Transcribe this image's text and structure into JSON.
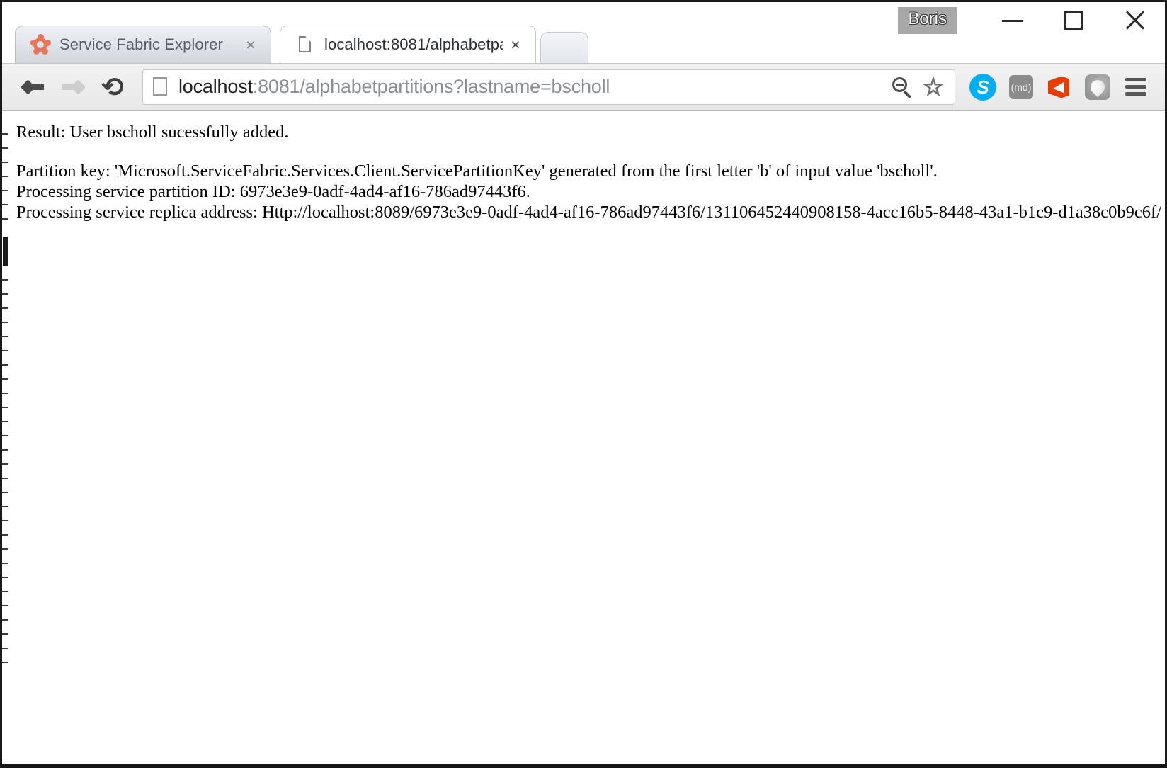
{
  "window": {
    "profile_label": "Boris",
    "controls": {
      "minimize": "minimize-button",
      "maximize": "maximize-button",
      "close": "close-button"
    }
  },
  "tabs": [
    {
      "title": "Service Fabric Explorer",
      "favicon": "service-fabric-molecule-icon",
      "close_label": "×",
      "active": false
    },
    {
      "title": "localhost:8081/alphabetpa",
      "favicon": "blank-page-icon",
      "close_label": "×",
      "active": true
    }
  ],
  "toolbar": {
    "back_label": "back-arrow",
    "forward_label": "forward-arrow",
    "reload_label": "⟳",
    "omnibox": {
      "page_icon": "document-icon",
      "url_host": "localhost",
      "url_rest": ":8081/alphabetpartitions?lastname=bscholl",
      "url_full": "localhost:8081/alphabetpartitions?lastname=bscholl",
      "zoom_out_icon": "zoom-out-icon",
      "bookmark_icon": "☆"
    },
    "extensions": [
      {
        "name": "skype-extension",
        "glyph": "S"
      },
      {
        "name": "md-extension",
        "glyph": "(md)"
      },
      {
        "name": "office-extension",
        "glyph": ""
      },
      {
        "name": "drop-extension",
        "glyph": ""
      }
    ],
    "menu_icon": "hamburger-menu-icon"
  },
  "content": {
    "lines": [
      "Result: User bscholl sucessfully added.",
      "",
      "Partition key: 'Microsoft.ServiceFabric.Services.Client.ServicePartitionKey' generated from the first letter 'b' of input value 'bscholl'.",
      "Processing service partition ID: 6973e3e9-0adf-4ad4-af16-786ad97443f6.",
      "Processing service replica address: Http://localhost:8089/6973e3e9-0adf-4ad4-af16-786ad97443f6/131106452440908158-4acc16b5-8448-43a1-b1c9-d1a38c0b9c6f/"
    ],
    "line_0": "Result: User bscholl sucessfully added.",
    "line_2": "Partition key: 'Microsoft.ServiceFabric.Services.Client.ServicePartitionKey' generated from the first letter 'b' of input value 'bscholl'.",
    "line_3": "Processing service partition ID: 6973e3e9-0adf-4ad4-af16-786ad97443f6.",
    "line_4": "Processing service replica address: Http://localhost:8089/6973e3e9-0adf-4ad4-af16-786ad97443f6/131106452440908158-4acc16b5-8448-43a1-b1c9-d1a38c0b9c6f/"
  },
  "colors": {
    "accent_orange": "#e8765a",
    "skype_blue": "#00aff0",
    "office_orange": "#eb3c00",
    "toolbar_bg": "#ececec",
    "url_gray": "#8b8f94"
  }
}
